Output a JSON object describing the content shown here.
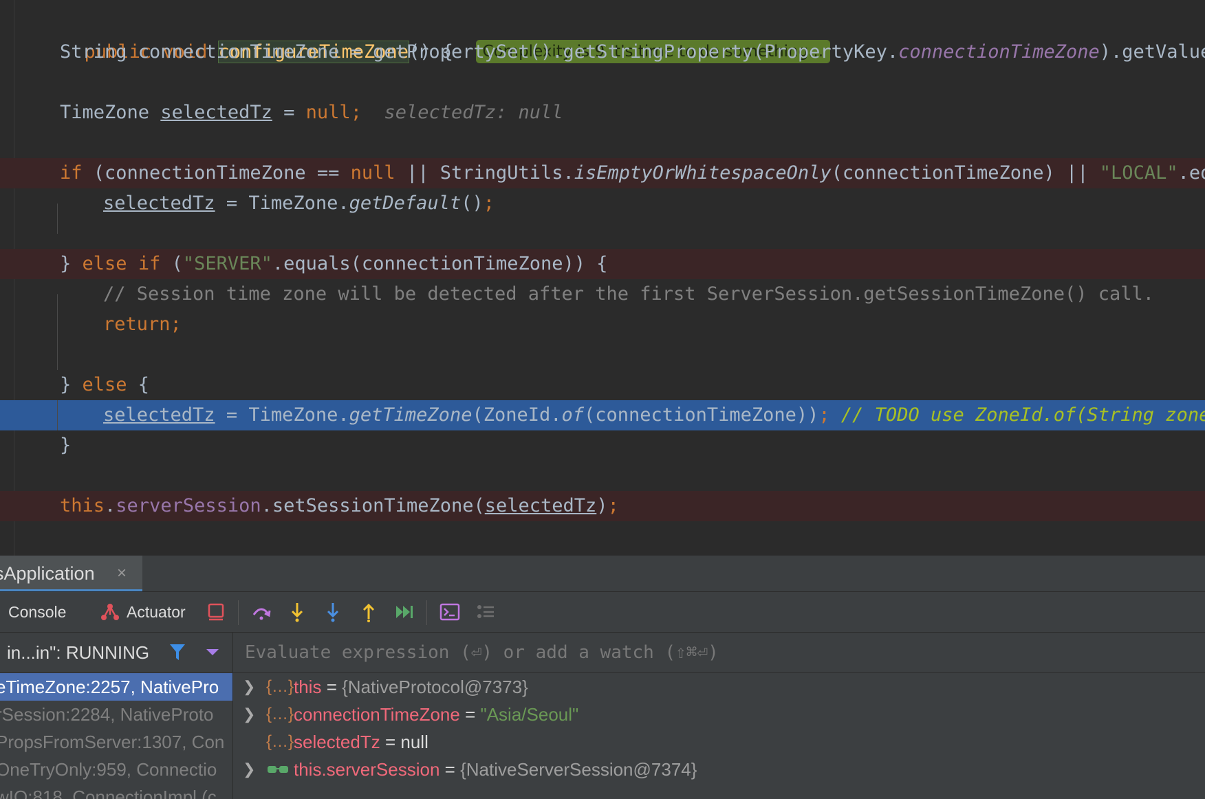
{
  "editor": {
    "line1": {
      "public": "public",
      "void": "void",
      "method": "configureTimeZone",
      "rest": "() {",
      "complexity_hint": "Complexity is 9 It's time to do something..."
    },
    "line2": {
      "a": "String connectionTimeZone = getPropertySet().getStringProperty(PropertyKey.",
      "b": "connectionTimeZone",
      "c": ").getValue()",
      "d": ";"
    },
    "line3": {
      "a": "TimeZone ",
      "b": "selectedTz",
      "c": " = ",
      "d": "null",
      "e": ";",
      "hint": "selectedTz: null"
    },
    "line4": {
      "if": "if",
      "a": " (connectionTimeZone == ",
      "null": "null",
      "b": " || StringUtils.",
      "m": "isEmptyOrWhitespaceOnly",
      "c": "(connectionTimeZone) || ",
      "s": "\"LOCAL\"",
      "d": ".equals"
    },
    "line5": {
      "a": "selectedTz",
      "b": " = TimeZone.",
      "m": "getDefault",
      "c": "()",
      "d": ";"
    },
    "line6": {
      "a": "} ",
      "else": "else",
      "if": "if",
      "b": " (",
      "s": "\"SERVER\"",
      "c": ".equals(connectionTimeZone)) {"
    },
    "line7": {
      "comment": "// Session time zone will be detected after the first ServerSession.getSessionTimeZone() call."
    },
    "line8": {
      "a": "return",
      "b": ";"
    },
    "line9": {
      "a": "} ",
      "else": "else",
      "b": " {"
    },
    "line10": {
      "a": "selectedTz",
      "b": " = TimeZone.",
      "m1": "getTimeZone",
      "c": "(ZoneId.",
      "m2": "of",
      "d": "(connectionTimeZone))",
      "e": ";",
      "todo": " // TODO use ZoneId.of(String zoneId,"
    },
    "line11": {
      "a": "}"
    },
    "line12": {
      "this": "this",
      "dot": ".",
      "field": "serverSession",
      "a": ".setSessionTimeZone(",
      "var": "selectedTz",
      "b": ")",
      "c": ";"
    }
  },
  "debug": {
    "tab_label": "sApplication",
    "tab_close": "×",
    "toolbar": {
      "console": "Console",
      "actuator": "Actuator"
    },
    "thread": "in...in\": RUNNING",
    "frames": [
      "eTimeZone:2257, NativePro",
      "rSession:2284, NativeProto",
      "PropsFromServer:1307, Con",
      "OneTryOnly:959, Connectio",
      "wIO:818, ConnectionImpl (c"
    ],
    "eval_placeholder": "Evaluate expression (⏎) or add a watch (⇧⌘⏎)",
    "variables": [
      {
        "name": "this",
        "eq": " = ",
        "value": "{NativeProtocol@7373}"
      },
      {
        "name": "connectionTimeZone",
        "eq": " = ",
        "value": "\"Asia/Seoul\""
      },
      {
        "name": "selectedTz",
        "eq": " = ",
        "value": "null"
      },
      {
        "name": "this.serverSession",
        "eq": " = ",
        "value": "{NativeServerSession@7374}"
      }
    ]
  },
  "colors": {
    "editor_bg": "#2b2b2b",
    "error_line_bg": "#3b2526",
    "current_line_bg": "#2d5a99",
    "keyword": "#cc7832",
    "method_decl": "#ffc66d",
    "field": "#9876aa",
    "string": "#6a8759",
    "comment": "#808080",
    "complexity_badge": "#5b7a2b",
    "selected_frame": "#4b6eaf"
  }
}
